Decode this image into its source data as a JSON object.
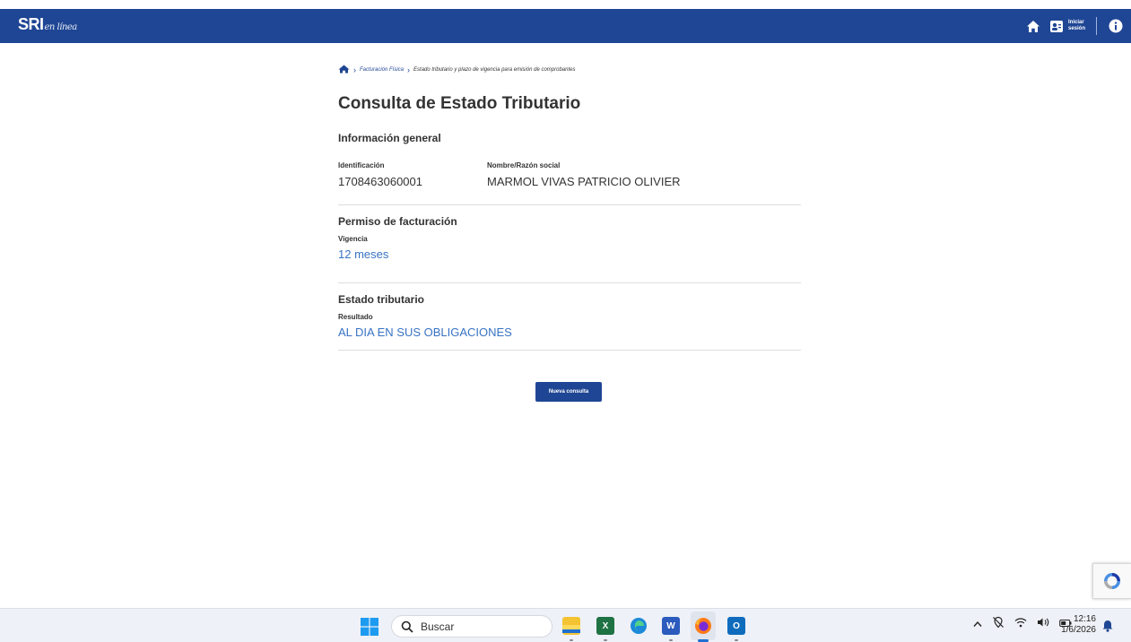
{
  "header": {
    "brand_main": "SRI",
    "brand_sub": "en línea",
    "login_line1": "Iniciar",
    "login_line2": "sesión"
  },
  "breadcrumb": {
    "item1": "Facturación Física",
    "item2": "Estado tributario y plazo de vigencia para emisión de comprobantes"
  },
  "page": {
    "title": "Consulta de Estado Tributario"
  },
  "info_general": {
    "title": "Información general",
    "id_label": "Identificación",
    "id_value": "1708463060001",
    "name_label": "Nombre/Razón social",
    "name_value": "MARMOL VIVAS PATRICIO OLIVIER"
  },
  "permiso": {
    "title": "Permiso de facturación",
    "label": "Vigencia",
    "value": "12 meses"
  },
  "estado": {
    "title": "Estado tributario",
    "label": "Resultado",
    "value": "AL DIA EN SUS OBLIGACIONES"
  },
  "actions": {
    "nueva_consulta": "Nueva consulta"
  },
  "taskbar": {
    "search_placeholder": "Buscar",
    "time": "12:16",
    "date": "1/6/2026"
  },
  "colors": {
    "brand_blue": "#1f4694",
    "value_blue": "#3873c4"
  }
}
